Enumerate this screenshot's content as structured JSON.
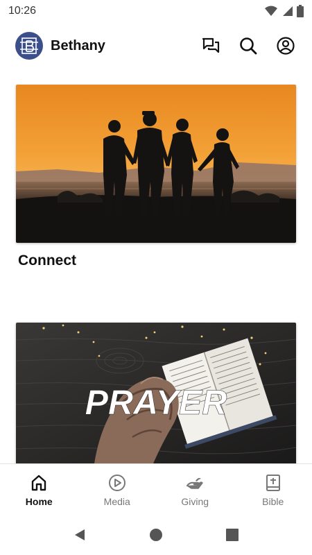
{
  "status_bar": {
    "time": "10:26",
    "icons": [
      "wifi-icon",
      "signal-icon",
      "battery-icon"
    ]
  },
  "header": {
    "logo_icon": "church-logo-icon",
    "title": "Bethany",
    "actions": [
      {
        "name": "chat-icon"
      },
      {
        "name": "search-icon"
      },
      {
        "name": "profile-icon"
      }
    ]
  },
  "feed": {
    "cards": [
      {
        "title": "Connect",
        "image": "family-silhouette-sunset"
      },
      {
        "title": "",
        "image_text": "PRAYER",
        "image": "praying-hands-bible"
      }
    ]
  },
  "bottom_nav": {
    "items": [
      {
        "label": "Home",
        "icon": "home-icon",
        "active": true
      },
      {
        "label": "Media",
        "icon": "play-circle-icon",
        "active": false
      },
      {
        "label": "Giving",
        "icon": "giving-hand-icon",
        "active": false
      },
      {
        "label": "Bible",
        "icon": "bible-icon",
        "active": false
      }
    ]
  },
  "colors": {
    "logo_bg": "#3d4f8a",
    "active_nav": "#111111",
    "inactive_nav": "#777777"
  }
}
